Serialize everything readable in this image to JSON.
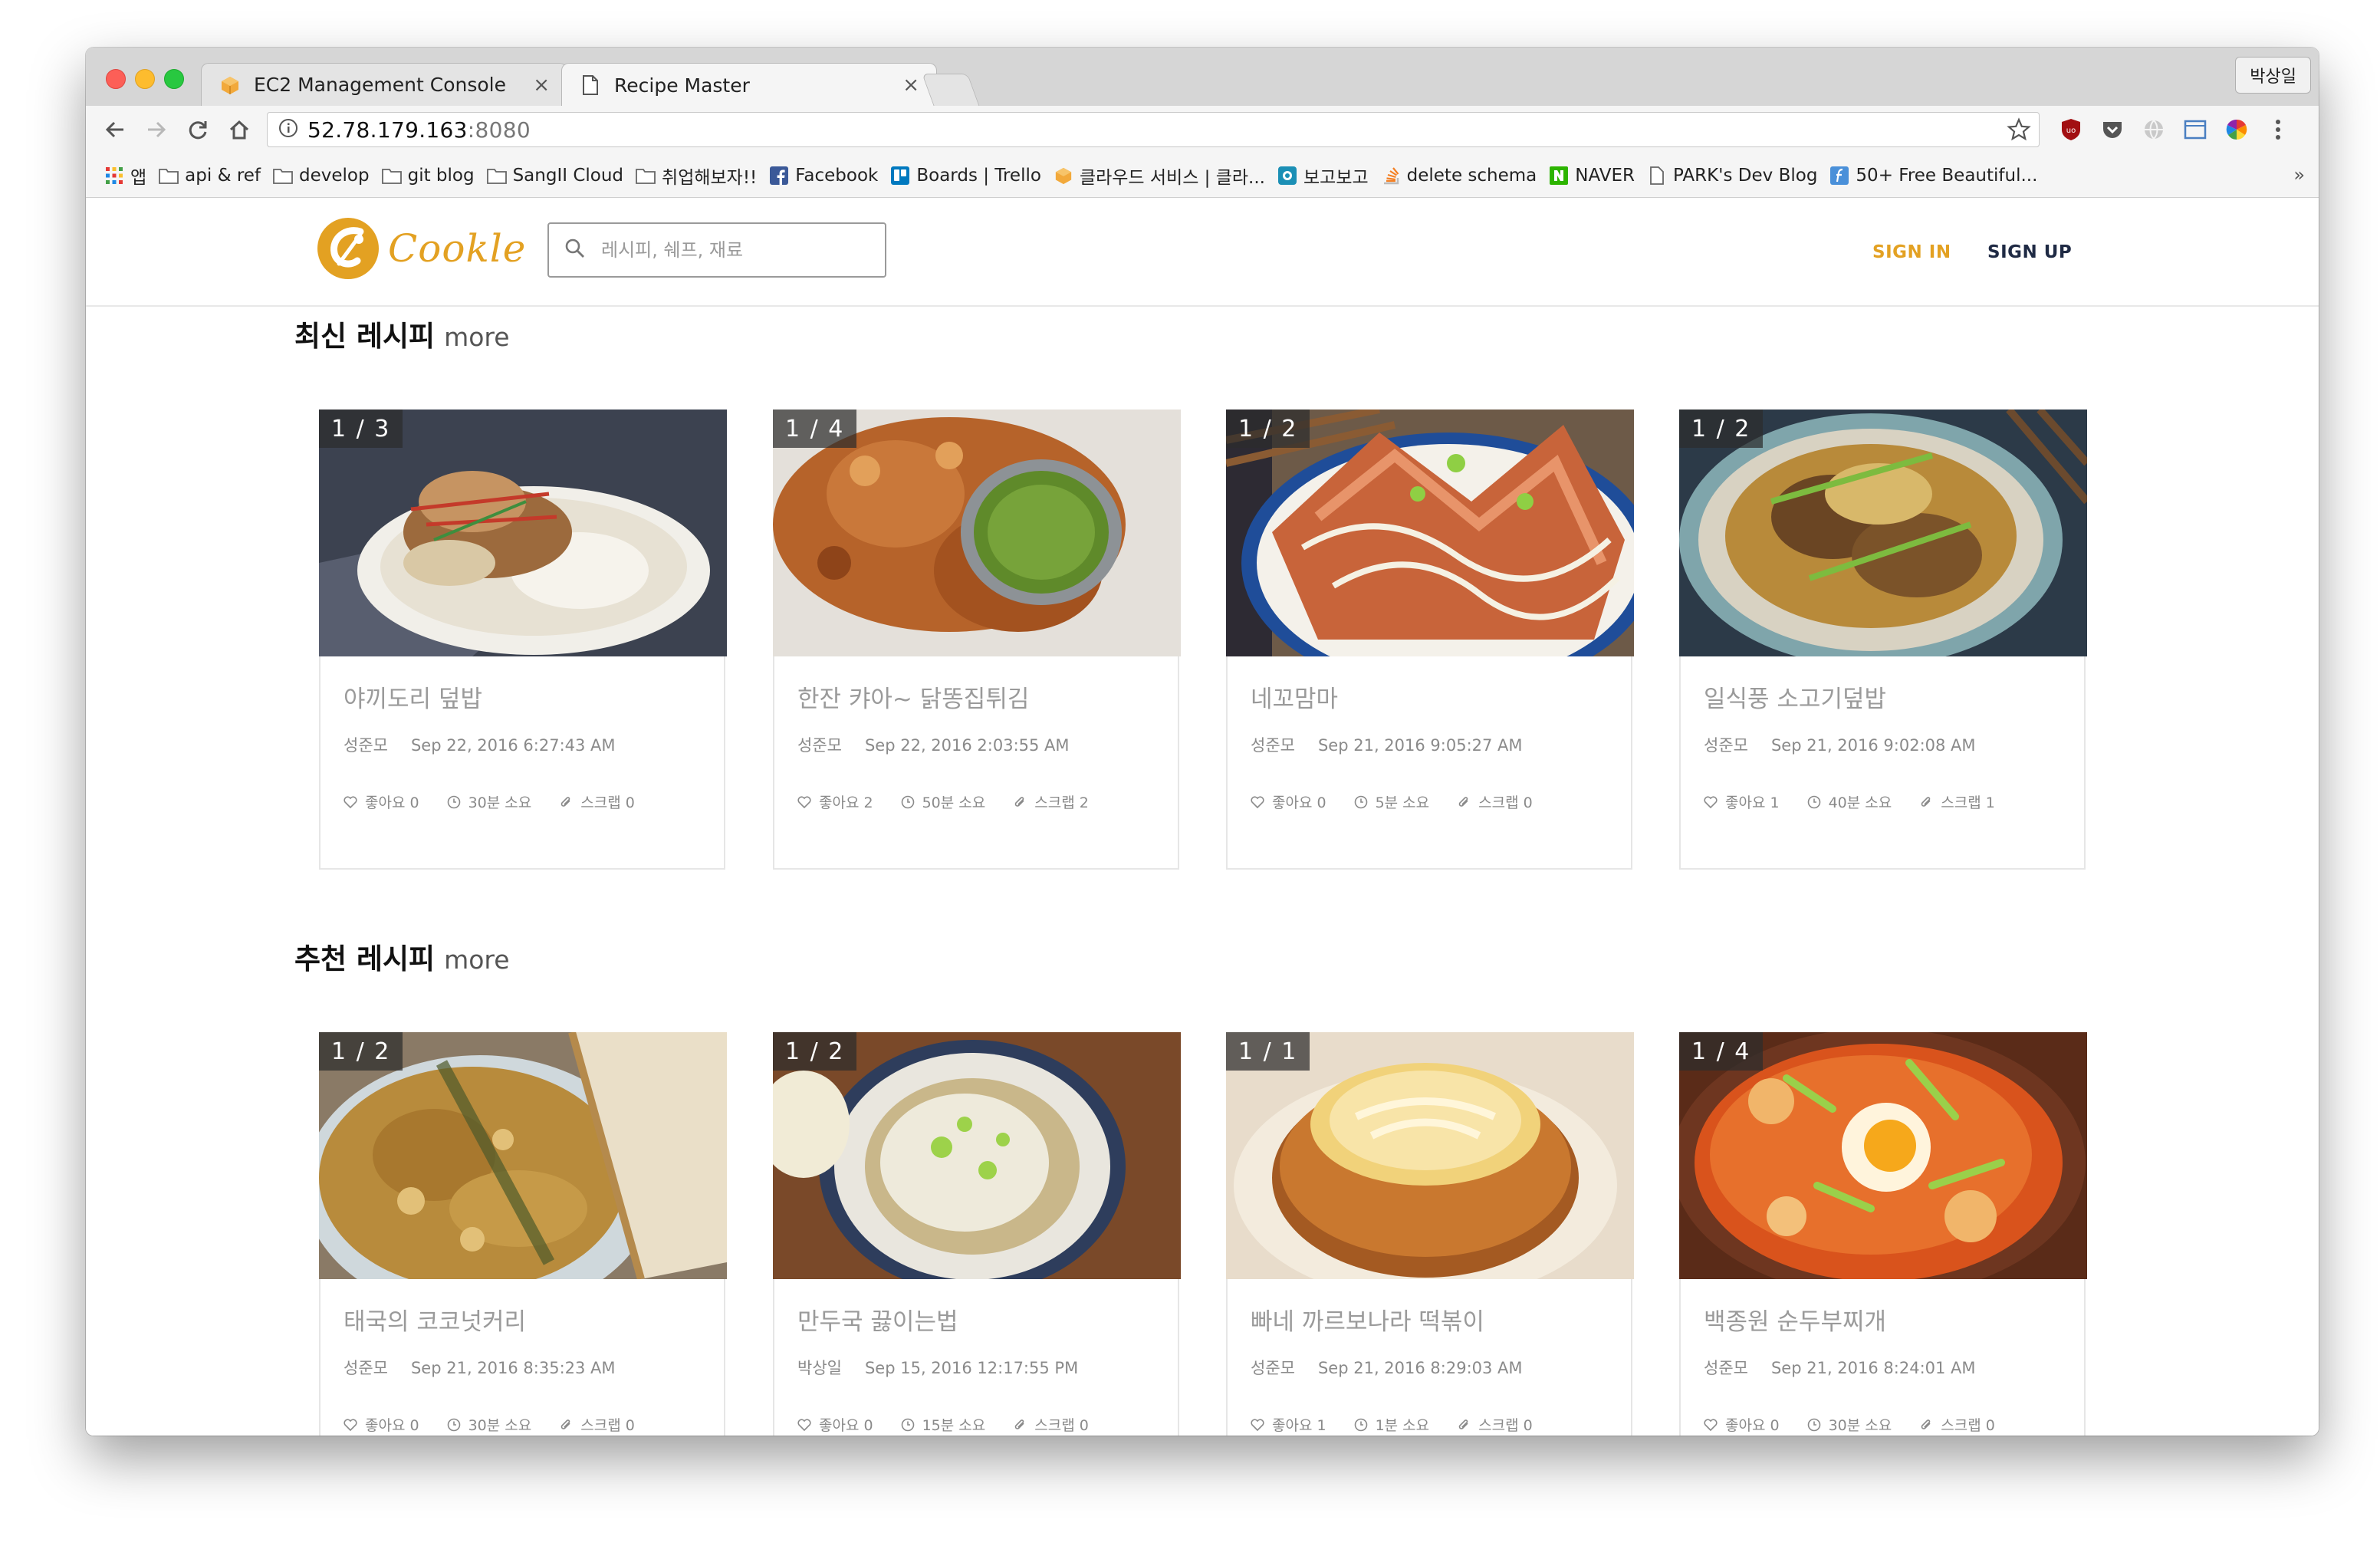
{
  "browser": {
    "tabs": [
      {
        "title": "EC2 Management Console",
        "close": "×"
      },
      {
        "title": "Recipe Master",
        "close": "×"
      }
    ],
    "profile": "박상일",
    "url_host": "52.78.179.163",
    "url_port": ":8080",
    "bookmarks": [
      {
        "label": "앱",
        "icon": "apps-grid-icon"
      },
      {
        "label": "api & ref",
        "icon": "folder-icon"
      },
      {
        "label": "develop",
        "icon": "folder-icon"
      },
      {
        "label": "git blog",
        "icon": "folder-icon"
      },
      {
        "label": "SangII Cloud",
        "icon": "folder-icon"
      },
      {
        "label": "취업해보자!!",
        "icon": "folder-icon"
      },
      {
        "label": "Facebook",
        "icon": "facebook-icon"
      },
      {
        "label": "Boards | Trello",
        "icon": "trello-icon"
      },
      {
        "label": "클라우드 서비스 | 클라...",
        "icon": "aws-icon"
      },
      {
        "label": "보고보고",
        "icon": "bogo-icon"
      },
      {
        "label": "delete schema",
        "icon": "stack-icon"
      },
      {
        "label": "NAVER",
        "icon": "naver-icon"
      },
      {
        "label": "PARK's Dev Blog",
        "icon": "page-icon"
      },
      {
        "label": "50+ Free Beautiful...",
        "icon": "f-icon"
      }
    ],
    "bookmarks_more": "»"
  },
  "site": {
    "logo_text": "Cookle",
    "search_placeholder": "레시피, 쉐프, 재료",
    "sign_in": "SIGN IN",
    "sign_up": "SIGN UP"
  },
  "sections": [
    {
      "title": "최신 레시피",
      "more": "more",
      "cards": [
        {
          "badge": "1 / 3",
          "title": "야끼도리 덮밥",
          "author": "성준모",
          "date": "Sep 22, 2016 6:27:43 AM",
          "likes": "좋아요 0",
          "time": "30분 소요",
          "scraps": "스크랩 0"
        },
        {
          "badge": "1 / 4",
          "title": "한잔 캬아~ 닭똥집튀김",
          "author": "성준모",
          "date": "Sep 22, 2016 2:03:55 AM",
          "likes": "좋아요 2",
          "time": "50분 소요",
          "scraps": "스크랩 2"
        },
        {
          "badge": "1 / 2",
          "title": "네꼬맘마",
          "author": "성준모",
          "date": "Sep 21, 2016 9:05:27 AM",
          "likes": "좋아요 0",
          "time": "5분 소요",
          "scraps": "스크랩 0"
        },
        {
          "badge": "1 / 2",
          "title": "일식풍 소고기덮밥",
          "author": "성준모",
          "date": "Sep 21, 2016 9:02:08 AM",
          "likes": "좋아요 1",
          "time": "40분 소요",
          "scraps": "스크랩 1"
        }
      ]
    },
    {
      "title": "추천 레시피",
      "more": "more",
      "cards": [
        {
          "badge": "1 / 2",
          "title": "태국의 코코넛커리",
          "author": "성준모",
          "date": "Sep 21, 2016 8:35:23 AM",
          "likes": "좋아요 0",
          "time": "30분 소요",
          "scraps": "스크랩 0"
        },
        {
          "badge": "1 / 2",
          "title": "만두국 끓이는법",
          "author": "박상일",
          "date": "Sep 15, 2016 12:17:55 PM",
          "likes": "좋아요 0",
          "time": "15분 소요",
          "scraps": "스크랩 0"
        },
        {
          "badge": "1 / 1",
          "title": "빠네 까르보나라 떡볶이",
          "author": "성준모",
          "date": "Sep 21, 2016 8:29:03 AM",
          "likes": "좋아요 1",
          "time": "1분 소요",
          "scraps": "스크랩 0"
        },
        {
          "badge": "1 / 4",
          "title": "백종원 순두부찌개",
          "author": "성준모",
          "date": "Sep 21, 2016 8:24:01 AM",
          "likes": "좋아요 0",
          "time": "30분 소요",
          "scraps": "스크랩 0"
        }
      ]
    }
  ],
  "colors": {
    "accent": "#e3a122",
    "navy": "#1f2a44",
    "muted_text": "#9a9a9a"
  }
}
